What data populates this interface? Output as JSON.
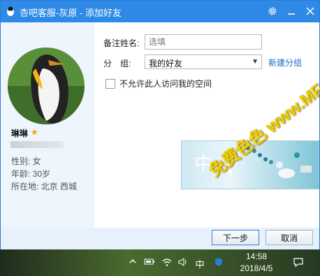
{
  "window": {
    "title": "杏吧客服-灰原 - 添加好友",
    "icons": {
      "app": "penguin-icon",
      "settings": "gear-icon",
      "minimize": "minimize-icon",
      "close": "close-icon"
    }
  },
  "profile": {
    "name": "琳琳",
    "badge_icon": "star-icon",
    "gender": "性别: 女",
    "age": "年龄: 30岁",
    "location": "所在地: 北京  西城"
  },
  "form": {
    "remark_label": "备注姓名:",
    "remark_placeholder": "选填",
    "group_label": "分　组:",
    "group_value": "我的好友",
    "new_group_link": "新建分组",
    "privacy_label": "不允许此人访问我的空间"
  },
  "banner": {
    "char": "中"
  },
  "buttons": {
    "next": "下一步",
    "cancel": "取消"
  },
  "watermark": "免费色色 www.MFsese.com",
  "taskbar": {
    "tray_icons": [
      "chevron-up-icon",
      "battery-icon",
      "wifi-icon",
      "volume-icon",
      "ime-icon",
      "shield-icon"
    ],
    "ime_label": "中",
    "time": "14:58",
    "date": "2018/4/5",
    "notification_icon": "notification-icon"
  }
}
